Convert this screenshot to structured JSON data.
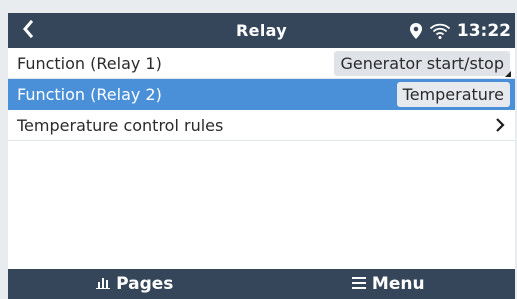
{
  "header": {
    "back_icon": "chevron-left-icon",
    "title": "Relay",
    "location_icon": "map-pin-icon",
    "wifi_icon": "wifi-icon",
    "time": "13:22"
  },
  "rows": [
    {
      "label": "Function (Relay 1)",
      "value": "Generator start/stop",
      "selected": false
    },
    {
      "label": "Function (Relay 2)",
      "value": "Temperature",
      "selected": true
    },
    {
      "label": "Temperature control rules",
      "value": "",
      "selected": false
    }
  ],
  "footer": {
    "pages_icon": "bar-chart-icon",
    "pages_label": "Pages",
    "menu_icon": "hamburger-menu-icon",
    "menu_label": "Menu"
  },
  "colors": {
    "header_bg": "#35465a",
    "selected_bg": "#4a90d9"
  }
}
